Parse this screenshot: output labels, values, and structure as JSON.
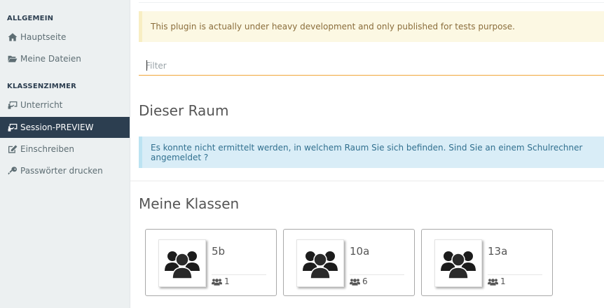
{
  "sidebar": {
    "section_general": "ALLGEMEIN",
    "section_classrooms": "KLASSENZIMMER",
    "items": [
      {
        "label": "Hauptseite",
        "icon": "home-icon"
      },
      {
        "label": "Meine Dateien",
        "icon": "folder-open-icon"
      },
      {
        "label": "Unterricht",
        "icon": "chalkboard-icon"
      },
      {
        "label": "Session-PREVIEW",
        "icon": "chalkboard-icon",
        "active": true
      },
      {
        "label": "Einschreiben",
        "icon": "edit-icon"
      },
      {
        "label": "Passwörter drucken",
        "icon": "key-icon"
      }
    ]
  },
  "main": {
    "warning_text": "This plugin is actually under heavy development and only published for tests purpose.",
    "filter_placeholder": "Filter",
    "room_heading": "Dieser Raum",
    "room_info": "Es konnte nicht ermittelt werden, in welchem Raum Sie sich befinden. Sind Sie an einem Schulrechner angemeldet ?",
    "classes_heading": "Meine Klassen",
    "classes": [
      {
        "name": "5b",
        "count": "1",
        "icon": "users-icon"
      },
      {
        "name": "10a",
        "count": "6",
        "icon": "users-icon"
      },
      {
        "name": "13a",
        "count": "1",
        "icon": "users-icon"
      }
    ]
  },
  "colors": {
    "sidebar_bg": "#ecf0f1",
    "sidebar_active": "#2c3e50",
    "warning_bg": "#fcf8e3",
    "info_bg": "#d9edf7",
    "filter_underline": "#f0a63a"
  }
}
